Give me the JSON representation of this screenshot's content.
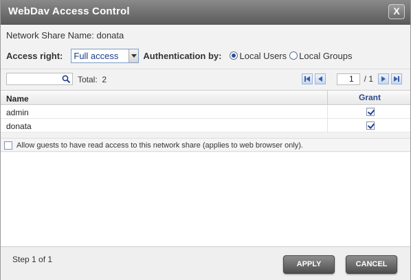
{
  "window": {
    "title": "WebDav Access Control",
    "close_label": "X"
  },
  "share": {
    "label": "Network Share Name: donata"
  },
  "access": {
    "label": "Access right:",
    "selected": "Full access",
    "auth_label": "Authentication by:",
    "options": [
      {
        "label": "Local Users",
        "checked": true
      },
      {
        "label": "Local Groups",
        "checked": false
      }
    ]
  },
  "toolbar": {
    "search_value": "",
    "total_label": "Total:",
    "total_count": "2",
    "page": "1",
    "page_of": "/ 1"
  },
  "grid": {
    "columns": [
      "Name",
      "Grant"
    ],
    "rows": [
      {
        "name": "admin",
        "grant": true
      },
      {
        "name": "donata",
        "grant": true
      }
    ]
  },
  "guest": {
    "label": "Allow guests to have read access to this network share (applies to web browser only).",
    "checked": false
  },
  "footer": {
    "step": "Step 1 of 1",
    "apply": "APPLY",
    "cancel": "CANCEL"
  },
  "colors": {
    "accent": "#2a4a8a",
    "titlebar": "#6e6e6e"
  }
}
